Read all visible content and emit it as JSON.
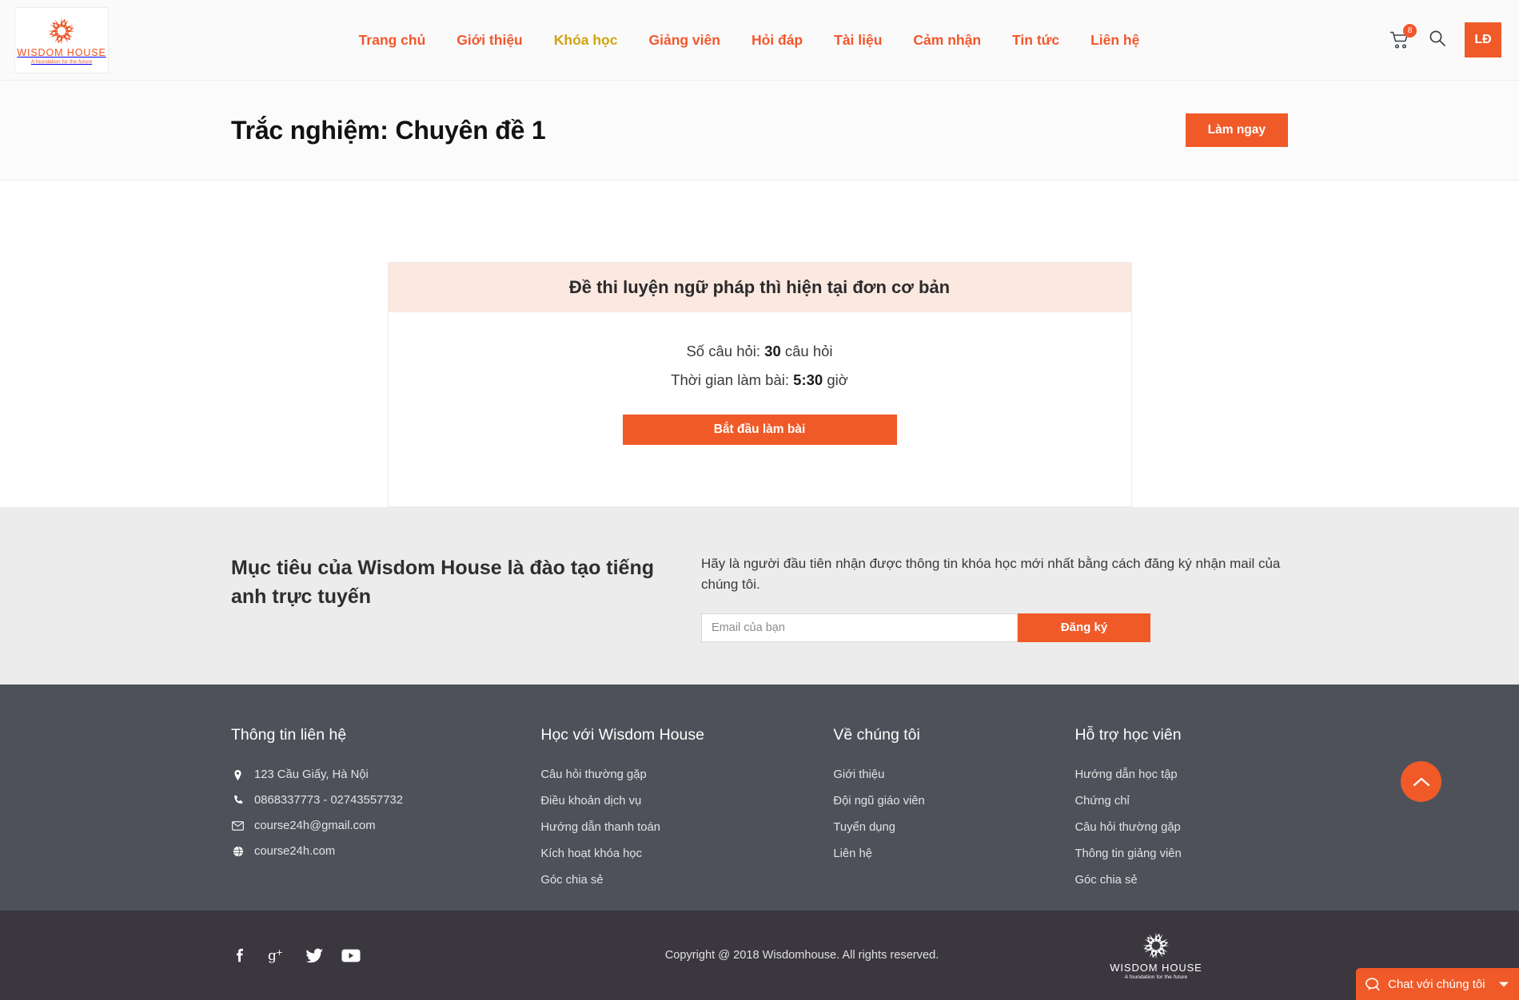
{
  "brand": {
    "name": "WISDOM HOUSE",
    "tagline": "A foundation for the future",
    "accent_color": "#f05a28",
    "active_nav_color": "#d1a310"
  },
  "header": {
    "nav": [
      {
        "label": "Trang chủ",
        "active": false
      },
      {
        "label": "Giới thiệu",
        "active": false
      },
      {
        "label": "Khóa học",
        "active": true
      },
      {
        "label": "Giảng viên",
        "active": false
      },
      {
        "label": "Hỏi đáp",
        "active": false
      },
      {
        "label": "Tài liệu",
        "active": false
      },
      {
        "label": "Cảm nhận",
        "active": false
      },
      {
        "label": "Tin tức",
        "active": false
      },
      {
        "label": "Liên hệ",
        "active": false
      }
    ],
    "cart_count": "8",
    "cart_icon": "shopping-cart-icon",
    "search_icon": "search-icon",
    "language_button": "LĐ"
  },
  "titlebar": {
    "title": "Trắc nghiệm: Chuyên đề 1",
    "action_label": "Làm ngay"
  },
  "quiz": {
    "heading": "Đề thi luyện ngữ pháp thì hiện tại đơn cơ bản",
    "questions_prefix": "Số câu hỏi:",
    "questions_count": "30",
    "questions_suffix": "câu hỏi",
    "duration_prefix": "Thời gian làm bài:",
    "duration_value": "5:30",
    "duration_suffix": "giờ",
    "start_label": "Bắt đầu làm bài"
  },
  "newsletter": {
    "heading": "Mục tiêu của Wisdom House là đào tạo tiếng anh trực tuyến",
    "description": "Hãy là người đầu tiên nhận được thông tin khóa học mới nhất bằng cách đăng ký nhận mail của chúng tôi.",
    "input_placeholder": "Email của bạn",
    "input_value": "",
    "submit_label": "Đăng ký"
  },
  "footer": {
    "contact": {
      "title": "Thông tin liên hệ",
      "items": [
        {
          "icon": "map-pin-icon",
          "text": "123 Cầu Giấy, Hà Nội"
        },
        {
          "icon": "phone-icon",
          "text": "0868337773 - 02743557732"
        },
        {
          "icon": "envelope-icon",
          "text": "course24h@gmail.com"
        },
        {
          "icon": "globe-icon",
          "text": "course24h.com"
        }
      ]
    },
    "learn": {
      "title": "Học với Wisdom House",
      "links": [
        "Câu hỏi thường gặp",
        "Điều khoản dịch vụ",
        "Hướng dẫn thanh toán",
        "Kích hoạt khóa học",
        "Góc chia sẻ"
      ]
    },
    "about": {
      "title": "Về chúng tôi",
      "links": [
        "Giới thiệu",
        "Đội ngũ giáo viên",
        "Tuyển dụng",
        "Liên hệ"
      ]
    },
    "support": {
      "title": "Hỗ trợ học viên",
      "links": [
        "Hướng dẫn học tập",
        "Chứng chỉ",
        "Câu hỏi thường gặp",
        "Thông tin giảng viên",
        "Góc chia sẻ"
      ]
    },
    "socials": [
      {
        "icon": "facebook-icon",
        "name": "Facebook"
      },
      {
        "icon": "google-plus-icon",
        "name": "Google Plus"
      },
      {
        "icon": "twitter-icon",
        "name": "Twitter"
      },
      {
        "icon": "youtube-icon",
        "name": "YouTube"
      }
    ],
    "copyright": "Copyright @ 2018 Wisdomhouse. All rights reserved."
  },
  "floating": {
    "scroll_top_icon": "chevron-up-icon",
    "chat_icon": "chat-bubble-icon",
    "chat_label": "Chat với chúng tôi",
    "chat_toggle_icon": "caret-down-icon"
  }
}
